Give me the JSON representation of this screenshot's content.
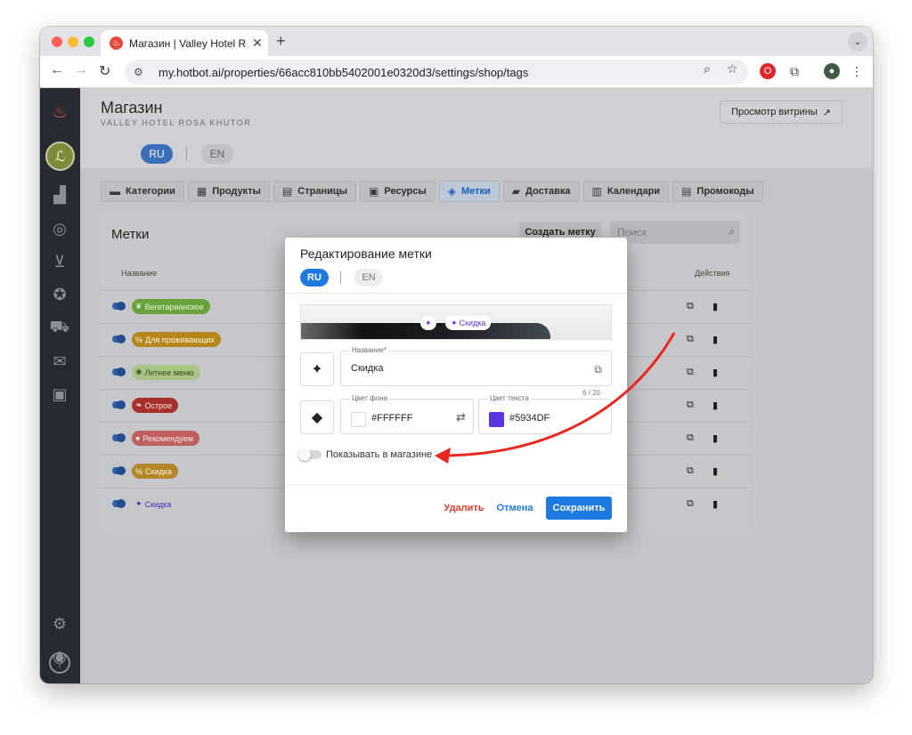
{
  "browser": {
    "tab_title": "Магазин | Valley Hotel Rosa Khutor",
    "tab_favicon": "flame-icon",
    "url": "my.hotbot.ai/properties/66acc810bb5402001e0320d3/settings/shop/tags",
    "traffic_lights": [
      "#ff5f57",
      "#febc2e",
      "#28c840"
    ]
  },
  "sidebar": {
    "logo": "flame-icon",
    "avatar_glyph": "ℒ",
    "items": [
      "analytics-icon",
      "check-circle-icon",
      "inbox-icon",
      "star-box-icon",
      "cart-icon",
      "mail-icon",
      "chat-icon"
    ],
    "bottom": [
      "gear-icon",
      "user-icon",
      "help-icon"
    ]
  },
  "header": {
    "title": "Магазин",
    "subtitle": "VALLEY HOTEL ROSA KHUTOR",
    "showcase_button": "Просмотр витрины",
    "showcase_icon": "↗",
    "lang_ru": "RU",
    "lang_en": "EN"
  },
  "nav_tabs": [
    {
      "label": "Категории",
      "icon": "▬"
    },
    {
      "label": "Продукты",
      "icon": "▦"
    },
    {
      "label": "Страницы",
      "icon": "▤"
    },
    {
      "label": "Ресурсы",
      "icon": "▣"
    },
    {
      "label": "Метки",
      "icon": "◈"
    },
    {
      "label": "Доставка",
      "icon": "▰"
    },
    {
      "label": "Календари",
      "icon": "▥"
    },
    {
      "label": "Промокоды",
      "icon": "▤"
    }
  ],
  "tags_card": {
    "title": "Метки",
    "create_button": "Создать метку",
    "search_placeholder": "Поиск",
    "col_name": "Название",
    "col_actions": "Действия",
    "rows": [
      {
        "label": "Вегетарианское",
        "icon": "❦",
        "bg": "#6aa23c",
        "fg": "#e8f5dc"
      },
      {
        "label": "Для проживающих",
        "icon": "%",
        "bg": "#b5861c",
        "fg": "#fff6dc"
      },
      {
        "label": "Летнее меню",
        "icon": "❀",
        "bg": "#a9c483",
        "fg": "#2f4a18"
      },
      {
        "label": "Острое",
        "icon": "❧",
        "bg": "#a8302a",
        "fg": "#ffe3e0"
      },
      {
        "label": "Рекомендуем",
        "icon": "♥",
        "bg": "#bd5f5f",
        "fg": "#ffe8e8"
      },
      {
        "label": "Скидка",
        "icon": "%",
        "bg": "#b4862a",
        "fg": "#fff3d6"
      },
      {
        "label": "Скидка",
        "icon": "✦",
        "bg": "transparent",
        "fg": "#3f2fb8"
      }
    ]
  },
  "modal": {
    "title": "Редактирование метки",
    "lang_ru": "RU",
    "lang_en": "EN",
    "preview_text": "Скидка",
    "name_label": "Название*",
    "name_value": "Скидка",
    "name_counter": "6 / 20",
    "bg_label": "Цвет фона",
    "bg_value": "#FFFFFF",
    "text_color_label": "Цвет текста",
    "text_color_value": "#5934DF",
    "show_in_shop_label": "Показывать в магазине",
    "show_in_shop": false,
    "delete_button": "Удалить",
    "cancel_button": "Отмена",
    "save_button": "Сохранить",
    "accent": "#1f7ae0",
    "danger": "#e53b2c"
  }
}
